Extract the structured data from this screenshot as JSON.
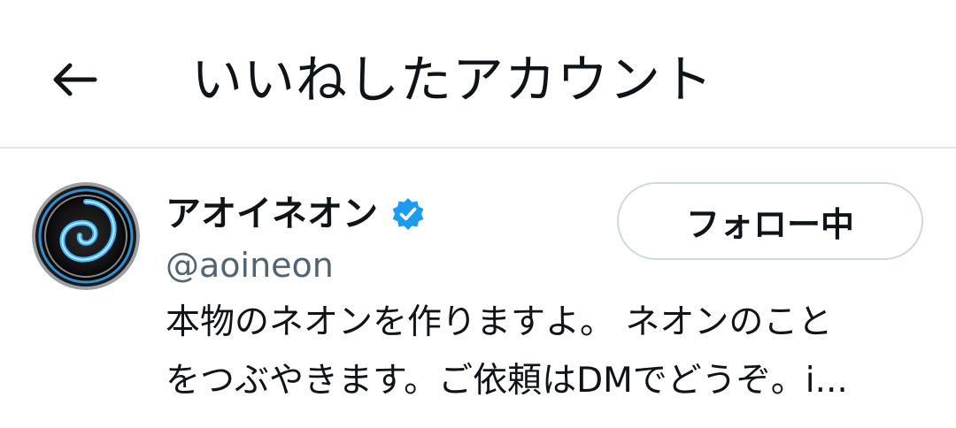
{
  "header": {
    "title": "いいねしたアカウント",
    "back_icon": "arrow-left-icon"
  },
  "user": {
    "display_name": "アオイネオン",
    "handle": "@aoineon",
    "verified": true,
    "verified_icon": "verified-badge-icon",
    "follow_button_label": "フォロー中",
    "bio_lines": [
      "本物のネオンを作りますよ。 ネオンのこと",
      "をつぶやきます。ご依頼はDMでどうぞ。i..."
    ]
  },
  "colors": {
    "verified_blue": "#1d9bf0",
    "divider": "#e1e8ed",
    "secondary_text": "#536471",
    "button_border": "#cfd9de",
    "avatar_neon": "#3fb7ff"
  }
}
